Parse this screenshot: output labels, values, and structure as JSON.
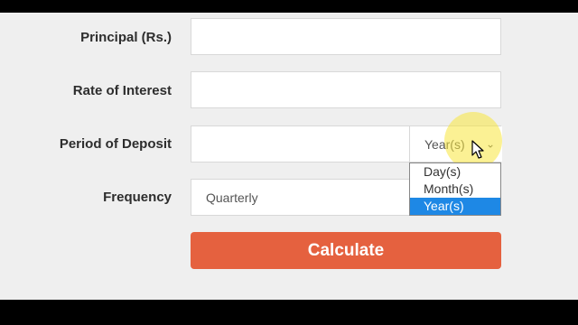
{
  "form": {
    "principal_label": "Principal (Rs.)",
    "principal_value": "",
    "rate_label": "Rate of Interest",
    "rate_value": "",
    "period_label": "Period of Deposit",
    "period_value": "",
    "period_unit_selected": "Year(s)",
    "period_unit_options": [
      "Day(s)",
      "Month(s)",
      "Year(s)"
    ],
    "frequency_label": "Frequency",
    "frequency_value": "Quarterly",
    "calculate_label": "Calculate"
  },
  "colors": {
    "button": "#e5613f",
    "selected_option": "#1e88e5",
    "cursor_highlight": "#f7e63c"
  },
  "icons": {
    "dropdown": "chevron-down-icon",
    "cursor": "mouse-pointer-icon"
  }
}
